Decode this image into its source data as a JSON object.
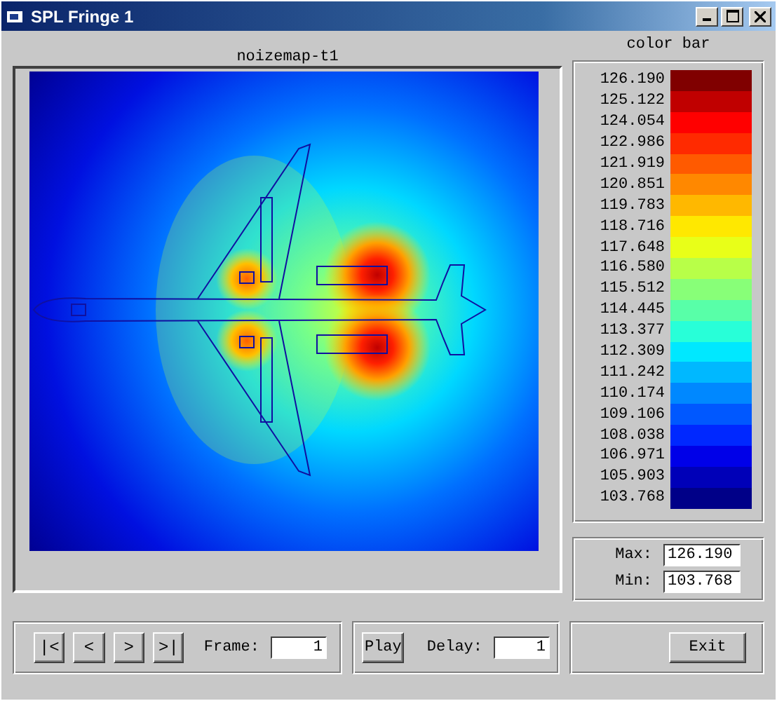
{
  "window": {
    "title": "SPL Fringe 1"
  },
  "map": {
    "title": "noizemap-t1"
  },
  "color_bar": {
    "title": "color bar",
    "levels": [
      {
        "label": "126.190",
        "color": "#800000"
      },
      {
        "label": "125.122",
        "color": "#c00000"
      },
      {
        "label": "124.054",
        "color": "#ff0000"
      },
      {
        "label": "122.986",
        "color": "#ff2a00"
      },
      {
        "label": "121.919",
        "color": "#ff5a00"
      },
      {
        "label": "120.851",
        "color": "#ff8800"
      },
      {
        "label": "119.783",
        "color": "#ffb800"
      },
      {
        "label": "118.716",
        "color": "#ffe800"
      },
      {
        "label": "117.648",
        "color": "#e8ff18"
      },
      {
        "label": "116.580",
        "color": "#b8ff48"
      },
      {
        "label": "115.512",
        "color": "#88ff78"
      },
      {
        "label": "114.445",
        "color": "#58ffa8"
      },
      {
        "label": "113.377",
        "color": "#28ffd8"
      },
      {
        "label": "112.309",
        "color": "#00e8ff"
      },
      {
        "label": "111.242",
        "color": "#00b8ff"
      },
      {
        "label": "110.174",
        "color": "#0088ff"
      },
      {
        "label": "109.106",
        "color": "#0058ff"
      },
      {
        "label": "108.038",
        "color": "#0028ff"
      },
      {
        "label": "106.971",
        "color": "#0000e8"
      },
      {
        "label": "105.903",
        "color": "#0000b8"
      },
      {
        "label": "103.768",
        "color": "#000088"
      }
    ]
  },
  "range": {
    "max_label": "Max:",
    "max_value": "126.190",
    "min_label": "Min:",
    "min_value": "103.768"
  },
  "playback": {
    "buttons": [
      "|<",
      "<",
      ">",
      ">|"
    ],
    "frame_label": "Frame:",
    "frame_value": "1",
    "play_button": "Play",
    "delay_label": "Delay:",
    "delay_value": "1"
  },
  "exit_button": "Exit"
}
